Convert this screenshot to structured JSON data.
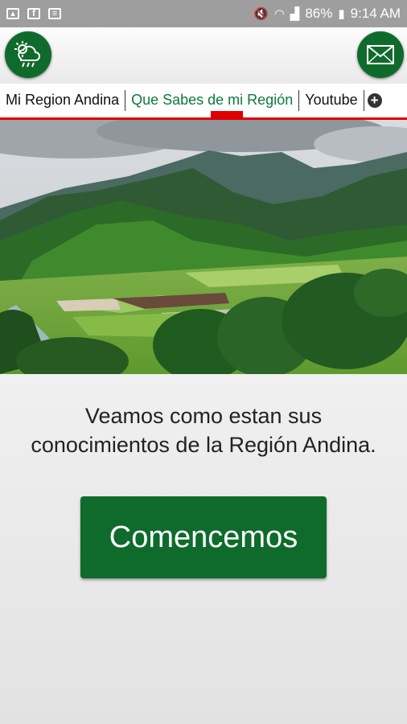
{
  "status_bar": {
    "battery": "86%",
    "time": "9:14 AM"
  },
  "app_bar": {
    "left_button_icon": "weather-cloud-rain-icon",
    "right_button_icon": "mail-envelope-icon"
  },
  "tabs": [
    {
      "label": "Mi Region Andina",
      "active": false
    },
    {
      "label": "Que Sabes de mi Región",
      "active": true
    },
    {
      "label": "Youtube",
      "active": false
    }
  ],
  "hero": {
    "icon": "landscape-mountains-image"
  },
  "content": {
    "intro_line1": "Veamos como estan sus",
    "intro_line2": "conocimientos de la Región Andina.",
    "start_label": "Comencemos"
  },
  "colors": {
    "primary_green": "#0f6b2b",
    "active_tab_text": "#0d7a3a",
    "tab_indicator": "#e00000",
    "status_bar": "#9e9e9e"
  }
}
